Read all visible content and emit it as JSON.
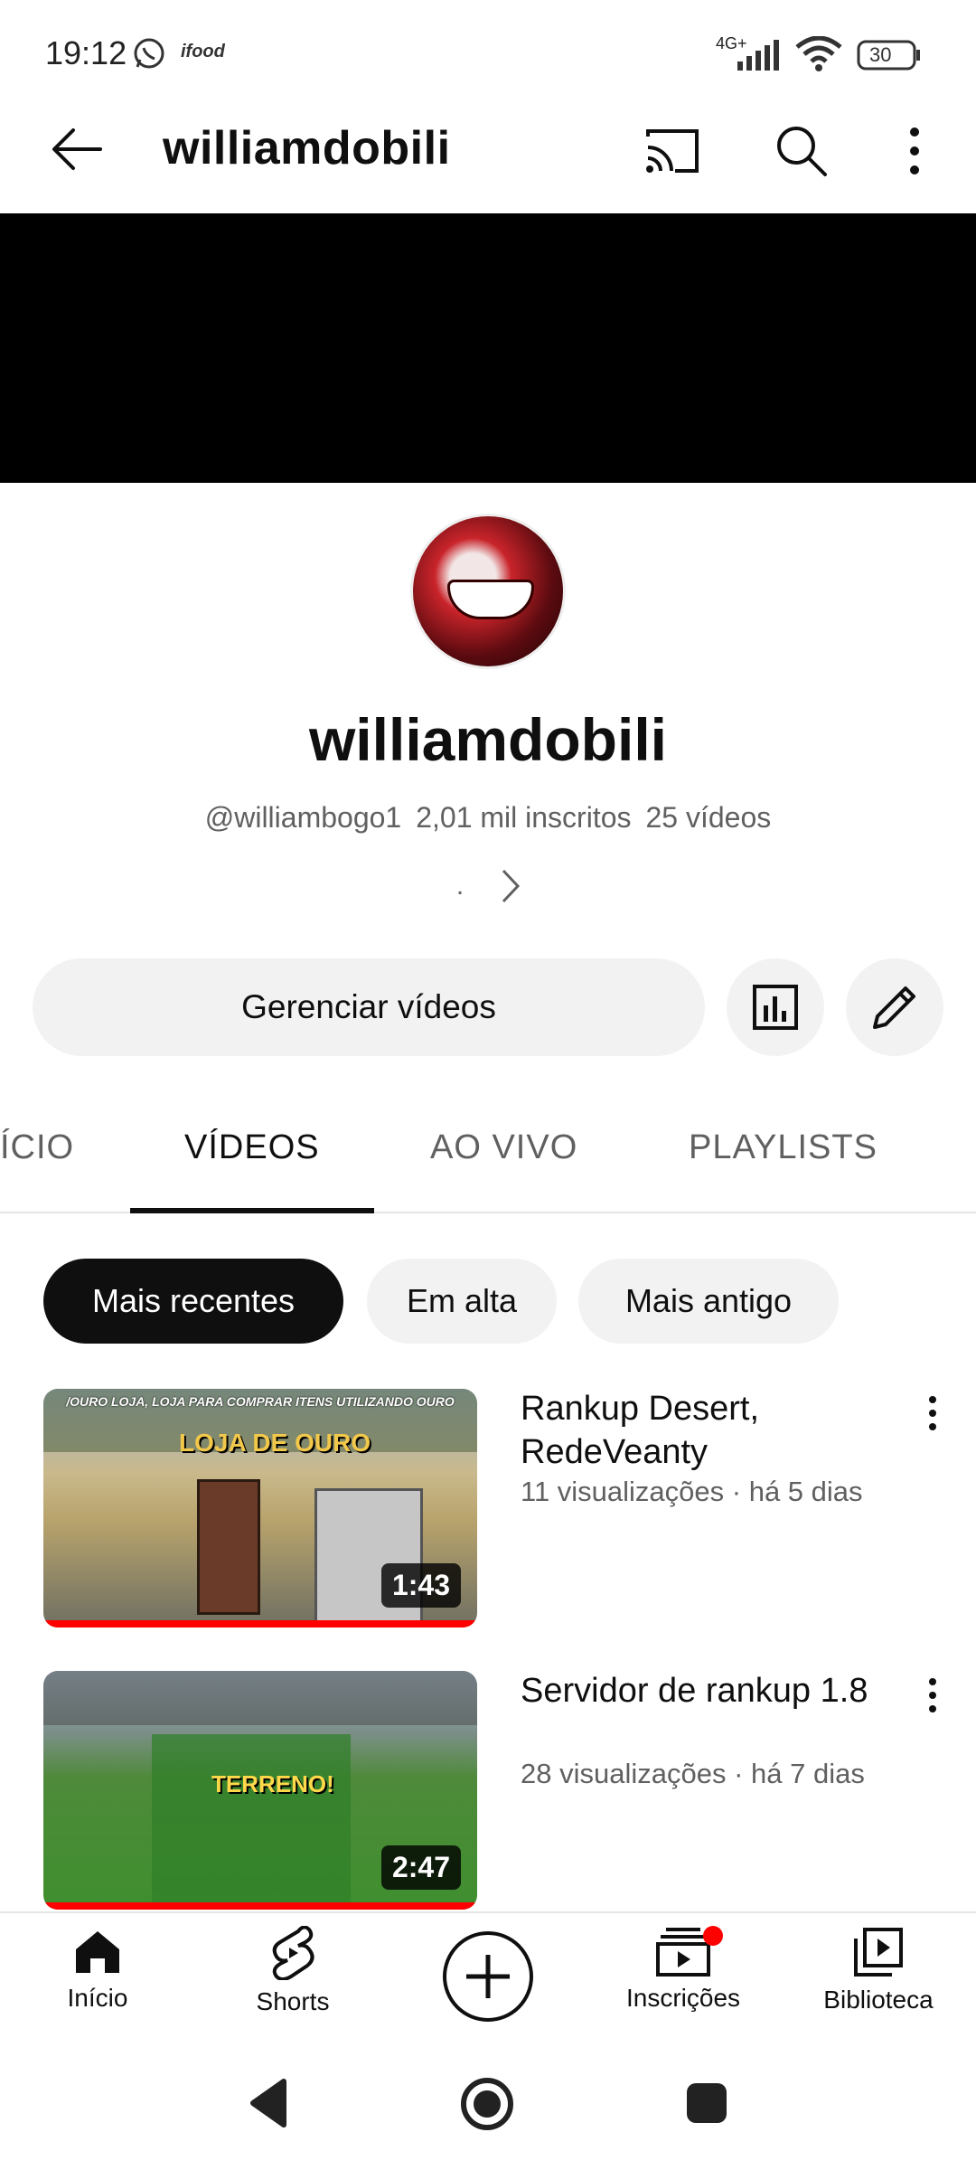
{
  "status_bar": {
    "time": "19:12",
    "carrier_app": "ifood",
    "network": "4G+",
    "battery": "30"
  },
  "appbar": {
    "title": "williamdobili",
    "icons": [
      "back-arrow-icon",
      "cast-icon",
      "search-icon",
      "more-vert-icon"
    ]
  },
  "channel": {
    "name": "williamdobili",
    "handle": "@williambogo1",
    "subscribers": "2,01 mil inscritos",
    "videos_count": "25 vídeos",
    "about_dot": "."
  },
  "actions": {
    "manage_label": "Gerenciar vídeos"
  },
  "tabs": [
    {
      "label": "ÍCIO"
    },
    {
      "label": "VÍDEOS"
    },
    {
      "label": "AO VIVO"
    },
    {
      "label": "PLAYLISTS"
    }
  ],
  "chips": [
    {
      "label": "Mais recentes"
    },
    {
      "label": "Em alta"
    },
    {
      "label": "Mais antigo"
    }
  ],
  "videos": [
    {
      "title": "Rankup Desert, RedeVeanty",
      "meta": "11 visualizações · há 5 dias",
      "duration": "1:43",
      "thumb_caption": "/OURO LOJA, LOJA PARA COMPRAR ITENS UTILIZANDO OURO",
      "thumb_sign": "LOJA DE OURO",
      "progress": 1.0
    },
    {
      "title": "Servidor de rankup 1.8",
      "meta": "28 visualizações · há 7 dias",
      "duration": "2:47",
      "thumb_sign": "TERRENO!",
      "progress": 1.0
    }
  ],
  "bottom_nav": [
    {
      "label": "Início"
    },
    {
      "label": "Shorts"
    },
    {
      "label": "Inscrições"
    },
    {
      "label": "Biblioteca"
    }
  ]
}
